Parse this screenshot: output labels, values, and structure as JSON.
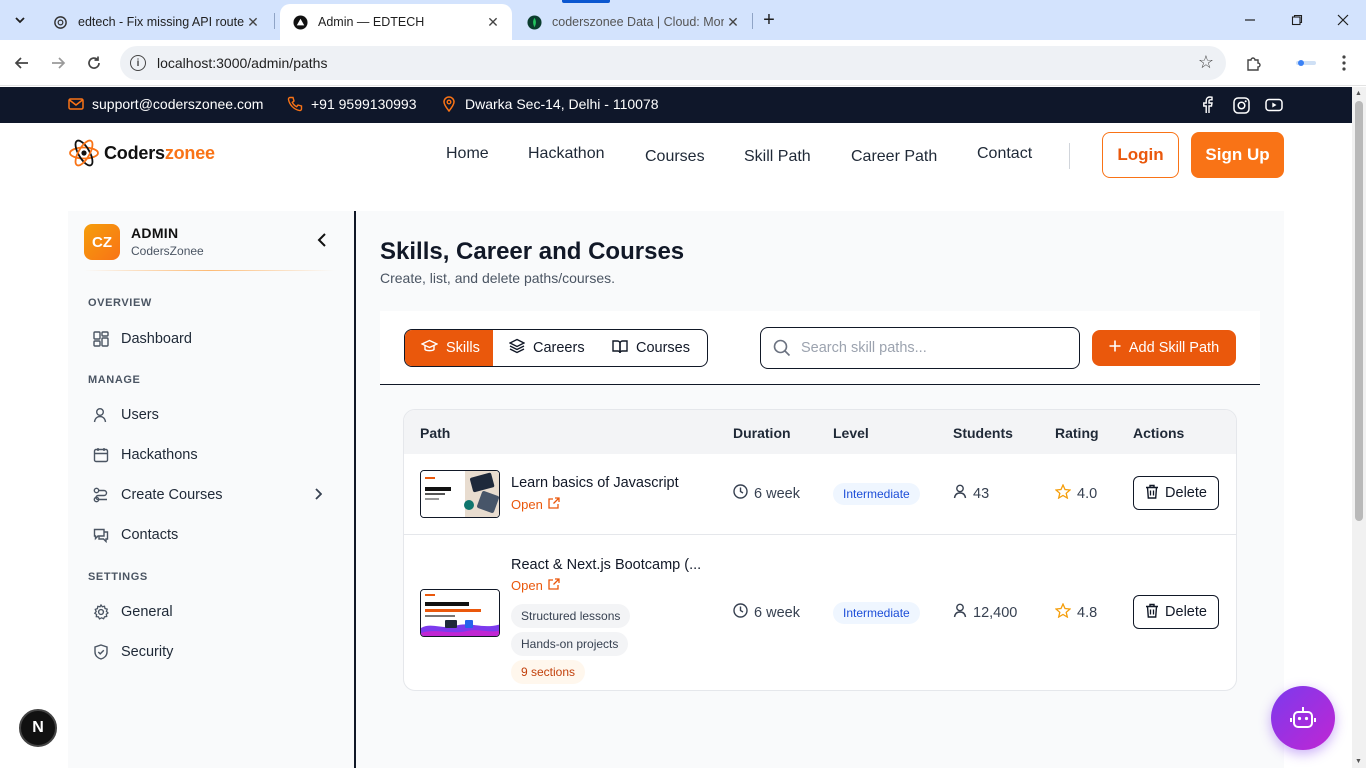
{
  "browser": {
    "tabs": [
      {
        "title": "edtech - Fix missing API routes",
        "active": false,
        "favicon": "chatgpt-icon"
      },
      {
        "title": "Admin — EDTECH",
        "active": true,
        "favicon": "vercel-triangle-icon"
      },
      {
        "title": "coderszonee Data | Cloud: Mon",
        "active": false,
        "favicon": "mongodb-leaf-icon"
      }
    ],
    "url": "localhost:3000/admin/paths"
  },
  "topbar": {
    "email": "support@coderszonee.com",
    "phone": "+91 9599130993",
    "address": "Dwarka Sec-14, Delhi - 110078"
  },
  "header": {
    "logo_main": "Coders",
    "logo_accent": "zonee",
    "nav": [
      "Home",
      "Hackathon",
      "Courses",
      "Skill Path",
      "Career Path",
      "Contact"
    ],
    "login_label": "Login",
    "signup_label": "Sign Up"
  },
  "sidebar": {
    "avatar_initials": "CZ",
    "user_name": "ADMIN",
    "org": "CodersZonee",
    "sections": {
      "overview": "OVERVIEW",
      "manage": "MANAGE",
      "settings": "SETTINGS"
    },
    "items": {
      "dashboard": "Dashboard",
      "users": "Users",
      "hackathons": "Hackathons",
      "create_courses": "Create Courses",
      "contacts": "Contacts",
      "general": "General",
      "security": "Security"
    }
  },
  "main": {
    "title": "Skills, Career and Courses",
    "subtitle": "Create, list, and delete paths/courses.",
    "tabs": {
      "skills": "Skills",
      "careers": "Careers",
      "courses": "Courses"
    },
    "active_tab": "Skills",
    "search_placeholder": "Search skill paths...",
    "add_button": "Add Skill Path",
    "columns": {
      "path": "Path",
      "duration": "Duration",
      "level": "Level",
      "students": "Students",
      "rating": "Rating",
      "actions": "Actions"
    },
    "rows": [
      {
        "title": "Learn basics of Javascript",
        "open_label": "Open",
        "duration": "6 week",
        "level": "Intermediate",
        "students": "43",
        "rating": "4.0",
        "delete_label": "Delete"
      },
      {
        "title": "React & Next.js Bootcamp (...",
        "open_label": "Open",
        "chips": [
          "Structured lessons",
          "Hands-on projects"
        ],
        "sections_chip": "9 sections",
        "duration": "6 week",
        "level": "Intermediate",
        "students": "12,400",
        "rating": "4.8",
        "delete_label": "Delete"
      }
    ]
  },
  "floating": {
    "next_badge": "N"
  },
  "colors": {
    "accent": "#ea580c",
    "brand_orange": "#f97316",
    "topbar_bg": "#0f172a",
    "level_badge": "#1d4ed8",
    "rating_star": "#f59e0b",
    "bot_gradient": "#7c3aed"
  }
}
